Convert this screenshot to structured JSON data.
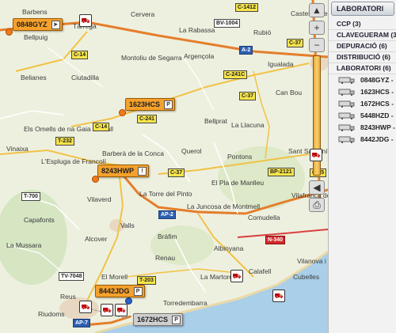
{
  "map": {
    "towns": [
      {
        "name": "Barbens"
      },
      {
        "name": "Tàrrega"
      },
      {
        "name": "Cervera"
      },
      {
        "name": "La Rabassa"
      },
      {
        "name": "Rubió"
      },
      {
        "name": "Castellolí de Ap"
      },
      {
        "name": "Bellpuig"
      },
      {
        "name": "Montoliu de Segarra"
      },
      {
        "name": "Argençola"
      },
      {
        "name": "Igualada"
      },
      {
        "name": "Ciutadilla"
      },
      {
        "name": "Belianes"
      },
      {
        "name": "Els Omells de na Gaia"
      },
      {
        "name": "Belltall"
      },
      {
        "name": "Bellprat"
      },
      {
        "name": "Can Bou"
      },
      {
        "name": "La Llacuna"
      },
      {
        "name": "Vinaixa"
      },
      {
        "name": "L'Espluga de Francolí"
      },
      {
        "name": "Barberà de la Conca"
      },
      {
        "name": "Querol"
      },
      {
        "name": "Pontons"
      },
      {
        "name": "Sant Sadurní"
      },
      {
        "name": "El Pla de Manlleu"
      },
      {
        "name": "La Torre del Pinto"
      },
      {
        "name": "Vilaverd"
      },
      {
        "name": "La Juncosa de Montmell"
      },
      {
        "name": "Vilafranca del Pe"
      },
      {
        "name": "Capafonts"
      },
      {
        "name": "Comudella"
      },
      {
        "name": "La Mussara"
      },
      {
        "name": "Alcover"
      },
      {
        "name": "Valls"
      },
      {
        "name": "Bràfim"
      },
      {
        "name": "Albinyana"
      },
      {
        "name": "Renau"
      },
      {
        "name": "Vilanova i"
      },
      {
        "name": "Cubelles"
      },
      {
        "name": "El Morell"
      },
      {
        "name": "La Martorella"
      },
      {
        "name": "Calafell"
      },
      {
        "name": "Reus"
      },
      {
        "name": "Torredembarra"
      },
      {
        "name": "Riudoms"
      }
    ],
    "roads": [
      {
        "code": "C-1412"
      },
      {
        "code": "BV-1004"
      },
      {
        "code": "C-37"
      },
      {
        "code": "A-2"
      },
      {
        "code": "C-14"
      },
      {
        "code": "C-241C"
      },
      {
        "code": "C-37"
      },
      {
        "code": "C-241"
      },
      {
        "code": "C-14"
      },
      {
        "code": "T-232"
      },
      {
        "code": "C-37"
      },
      {
        "code": "BP-2121"
      },
      {
        "code": "C-15"
      },
      {
        "code": "T-700"
      },
      {
        "code": "AP-2"
      },
      {
        "code": "N-340"
      },
      {
        "code": "T-203"
      },
      {
        "code": "TV-7048"
      },
      {
        "code": "AP-7"
      }
    ],
    "vehicle_tags": [
      {
        "plate": "0848GYZ"
      },
      {
        "plate": "1623HCS"
      },
      {
        "plate": "8243HWP"
      },
      {
        "plate": "8442JDG"
      },
      {
        "plate": "1672HCS"
      }
    ]
  },
  "sidebar": {
    "header": "LABORATORI",
    "groups": [
      {
        "label": "CCP (3)"
      },
      {
        "label": "CLAVEGUERAM (3)"
      },
      {
        "label": "DEPURACIÓ (6)"
      },
      {
        "label": "DISTRIBUCIÓ (6)"
      },
      {
        "label": "LABORATORI (6)"
      }
    ],
    "vehicles": [
      {
        "plate": "0848GYZ -"
      },
      {
        "plate": "1623HCS -"
      },
      {
        "plate": "1672HCS -"
      },
      {
        "plate": "5448HZD -"
      },
      {
        "plate": "8243HWP -"
      },
      {
        "plate": "8442JDG -"
      }
    ]
  }
}
